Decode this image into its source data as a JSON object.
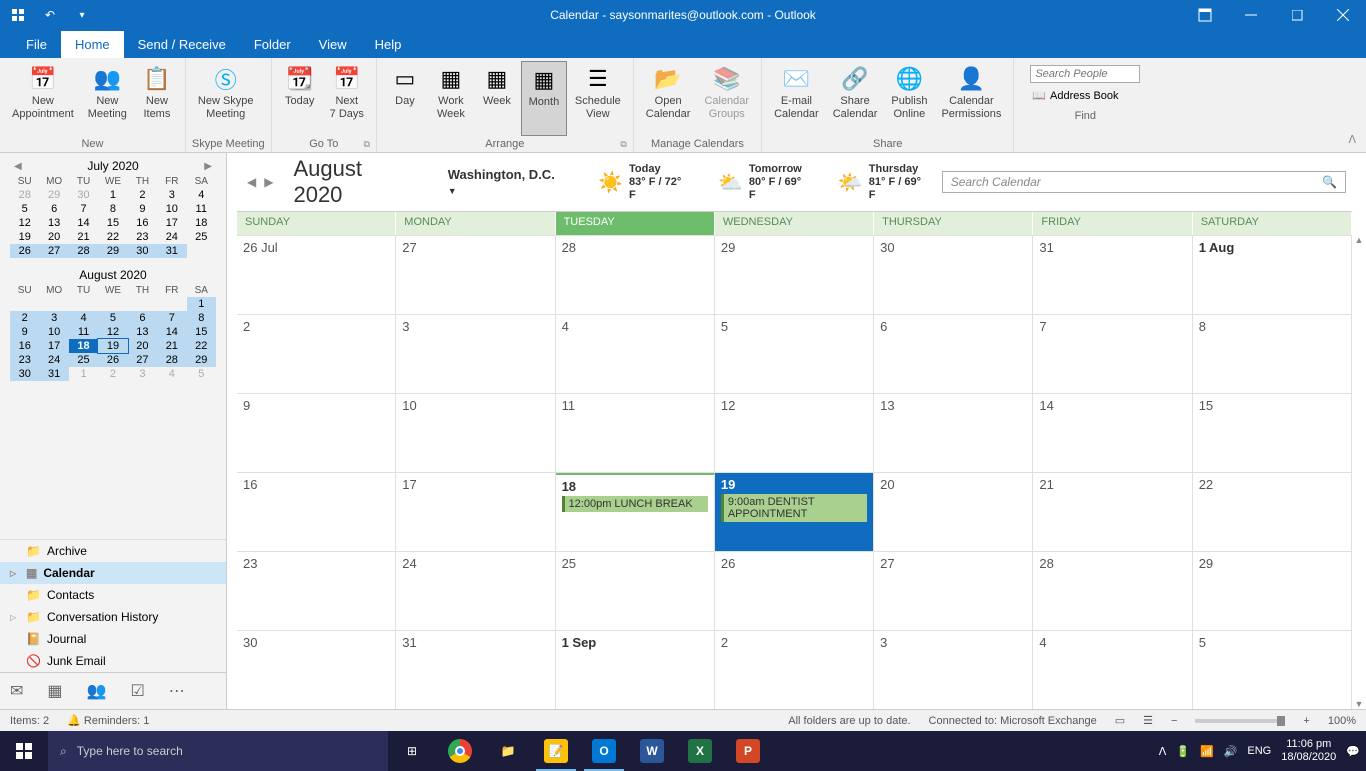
{
  "titlebar": {
    "title": "Calendar - saysonmarites@outlook.com  -  Outlook"
  },
  "menutabs": [
    "File",
    "Home",
    "Send / Receive",
    "Folder",
    "View",
    "Help"
  ],
  "active_tab": "Home",
  "ribbon": {
    "new": {
      "label": "New",
      "appointment": "New\nAppointment",
      "meeting": "New\nMeeting",
      "items": "New\nItems"
    },
    "skype": {
      "label": "Skype Meeting",
      "btn": "New Skype\nMeeting"
    },
    "goto": {
      "label": "Go To",
      "today": "Today",
      "next7": "Next\n7 Days"
    },
    "arrange": {
      "label": "Arrange",
      "day": "Day",
      "workweek": "Work\nWeek",
      "week": "Week",
      "month": "Month",
      "schedule": "Schedule\nView"
    },
    "manage": {
      "label": "Manage Calendars",
      "open": "Open\nCalendar",
      "groups": "Calendar\nGroups"
    },
    "share": {
      "label": "Share",
      "email": "E-mail\nCalendar",
      "sharecal": "Share\nCalendar",
      "publish": "Publish\nOnline",
      "perms": "Calendar\nPermissions"
    },
    "find": {
      "label": "Find",
      "search_placeholder": "Search People",
      "addr": "Address Book"
    }
  },
  "minical1": {
    "title": "July 2020",
    "dow": [
      "SU",
      "MO",
      "TU",
      "WE",
      "TH",
      "FR",
      "SA"
    ],
    "rows": [
      [
        {
          "d": "28",
          "o": 1
        },
        {
          "d": "29",
          "o": 1
        },
        {
          "d": "30",
          "o": 1
        },
        {
          "d": "1"
        },
        {
          "d": "2"
        },
        {
          "d": "3"
        },
        {
          "d": "4"
        }
      ],
      [
        {
          "d": "5"
        },
        {
          "d": "6"
        },
        {
          "d": "7"
        },
        {
          "d": "8"
        },
        {
          "d": "9"
        },
        {
          "d": "10"
        },
        {
          "d": "11"
        }
      ],
      [
        {
          "d": "12"
        },
        {
          "d": "13"
        },
        {
          "d": "14"
        },
        {
          "d": "15"
        },
        {
          "d": "16"
        },
        {
          "d": "17"
        },
        {
          "d": "18"
        }
      ],
      [
        {
          "d": "19"
        },
        {
          "d": "20"
        },
        {
          "d": "21"
        },
        {
          "d": "22"
        },
        {
          "d": "23"
        },
        {
          "d": "24"
        },
        {
          "d": "25"
        }
      ],
      [
        {
          "d": "26",
          "hl": 1
        },
        {
          "d": "27",
          "hl": 1
        },
        {
          "d": "28",
          "hl": 1
        },
        {
          "d": "29",
          "hl": 1
        },
        {
          "d": "30",
          "hl": 1
        },
        {
          "d": "31",
          "hl": 1
        },
        {
          "d": ""
        }
      ]
    ]
  },
  "minical2": {
    "title": "August 2020",
    "dow": [
      "SU",
      "MO",
      "TU",
      "WE",
      "TH",
      "FR",
      "SA"
    ],
    "rows": [
      [
        {
          "d": ""
        },
        {
          "d": ""
        },
        {
          "d": ""
        },
        {
          "d": ""
        },
        {
          "d": ""
        },
        {
          "d": ""
        },
        {
          "d": "1",
          "hl": 1
        }
      ],
      [
        {
          "d": "2",
          "hl": 1
        },
        {
          "d": "3",
          "hl": 1
        },
        {
          "d": "4",
          "hl": 1
        },
        {
          "d": "5",
          "hl": 1
        },
        {
          "d": "6",
          "hl": 1
        },
        {
          "d": "7",
          "hl": 1
        },
        {
          "d": "8",
          "hl": 1
        }
      ],
      [
        {
          "d": "9",
          "hl": 1
        },
        {
          "d": "10",
          "hl": 1
        },
        {
          "d": "11",
          "hl": 1
        },
        {
          "d": "12",
          "hl": 1
        },
        {
          "d": "13",
          "hl": 1
        },
        {
          "d": "14",
          "hl": 1
        },
        {
          "d": "15",
          "hl": 1
        }
      ],
      [
        {
          "d": "16",
          "hl": 1
        },
        {
          "d": "17",
          "hl": 1
        },
        {
          "d": "18",
          "hl": 1,
          "today": 1
        },
        {
          "d": "19",
          "hl": 1,
          "box": 1
        },
        {
          "d": "20",
          "hl": 1
        },
        {
          "d": "21",
          "hl": 1
        },
        {
          "d": "22",
          "hl": 1
        }
      ],
      [
        {
          "d": "23",
          "hl": 1
        },
        {
          "d": "24",
          "hl": 1
        },
        {
          "d": "25",
          "hl": 1
        },
        {
          "d": "26",
          "hl": 1
        },
        {
          "d": "27",
          "hl": 1
        },
        {
          "d": "28",
          "hl": 1
        },
        {
          "d": "29",
          "hl": 1
        }
      ],
      [
        {
          "d": "30",
          "hl": 1
        },
        {
          "d": "31",
          "hl": 1
        },
        {
          "d": "1",
          "o": 1
        },
        {
          "d": "2",
          "o": 1
        },
        {
          "d": "3",
          "o": 1
        },
        {
          "d": "4",
          "o": 1
        },
        {
          "d": "5",
          "o": 1
        }
      ]
    ]
  },
  "nav": {
    "archive": "Archive",
    "calendar": "Calendar",
    "contacts": "Contacts",
    "conversation": "Conversation History",
    "journal": "Journal",
    "junk": "Junk Email"
  },
  "calheader": {
    "month": "August 2020",
    "location": "Washington,  D.C.",
    "weather": [
      {
        "label": "Today",
        "temp": "83° F / 72° F",
        "icon": "☀️"
      },
      {
        "label": "Tomorrow",
        "temp": "80° F / 69° F",
        "icon": "⛅"
      },
      {
        "label": "Thursday",
        "temp": "81° F / 69° F",
        "icon": "🌤️"
      }
    ],
    "search_placeholder": "Search Calendar"
  },
  "dayheaders": [
    "SUNDAY",
    "MONDAY",
    "TUESDAY",
    "WEDNESDAY",
    "THURSDAY",
    "FRIDAY",
    "SATURDAY"
  ],
  "today_idx": 2,
  "weeks": [
    [
      {
        "l": "26 Jul"
      },
      {
        "l": "27"
      },
      {
        "l": "28"
      },
      {
        "l": "29"
      },
      {
        "l": "30"
      },
      {
        "l": "31"
      },
      {
        "l": "1 Aug",
        "bold": 1
      }
    ],
    [
      {
        "l": "2"
      },
      {
        "l": "3"
      },
      {
        "l": "4"
      },
      {
        "l": "5"
      },
      {
        "l": "6"
      },
      {
        "l": "7"
      },
      {
        "l": "8"
      }
    ],
    [
      {
        "l": "9"
      },
      {
        "l": "10"
      },
      {
        "l": "11"
      },
      {
        "l": "12"
      },
      {
        "l": "13"
      },
      {
        "l": "14"
      },
      {
        "l": "15"
      }
    ],
    [
      {
        "l": "16"
      },
      {
        "l": "17"
      },
      {
        "l": "18",
        "bold": 1,
        "today": 1,
        "events": [
          {
            "t": "12:00pm LUNCH BREAK"
          }
        ]
      },
      {
        "l": "19",
        "selected": 1,
        "events": [
          {
            "t": "9:00am DENTIST APPOINTMENT"
          }
        ]
      },
      {
        "l": "20"
      },
      {
        "l": "21"
      },
      {
        "l": "22"
      }
    ],
    [
      {
        "l": "23"
      },
      {
        "l": "24"
      },
      {
        "l": "25"
      },
      {
        "l": "26"
      },
      {
        "l": "27"
      },
      {
        "l": "28"
      },
      {
        "l": "29"
      }
    ],
    [
      {
        "l": "30"
      },
      {
        "l": "31"
      },
      {
        "l": "1 Sep",
        "bold": 1
      },
      {
        "l": "2"
      },
      {
        "l": "3"
      },
      {
        "l": "4"
      },
      {
        "l": "5"
      }
    ]
  ],
  "status": {
    "items": "Items: 2",
    "reminders": "Reminders: 1",
    "sync": "All folders are up to date.",
    "connected": "Connected to: Microsoft Exchange",
    "zoom": "100%"
  },
  "taskbar": {
    "search_placeholder": "Type here to search",
    "lang": "ENG",
    "time": "11:06 pm",
    "date": "18/08/2020"
  }
}
